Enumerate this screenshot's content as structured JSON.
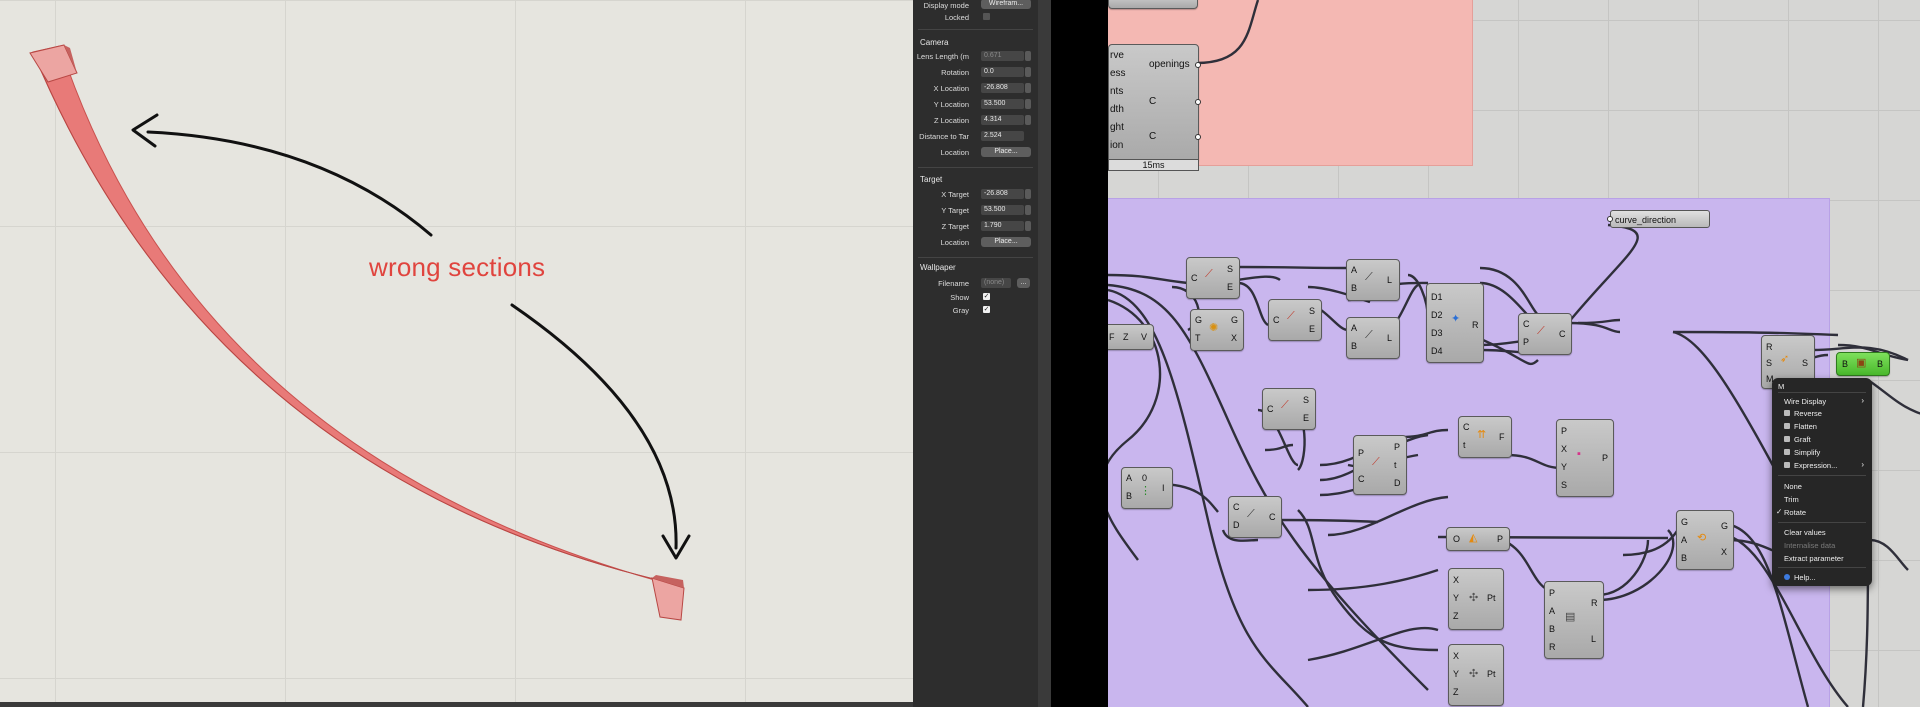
{
  "viewport": {
    "annotation": "wrong sections"
  },
  "panel": {
    "top_row": {
      "label": "Display mode",
      "value": "Wirefram..."
    },
    "locked_label": "Locked",
    "camera_title": "Camera",
    "camera": [
      {
        "label": "Lens Length (m",
        "value": "0.671"
      },
      {
        "label": "Rotation",
        "value": "0.0"
      },
      {
        "label": "X Location",
        "value": "-26.808"
      },
      {
        "label": "Y Location",
        "value": "53.500"
      },
      {
        "label": "Z Location",
        "value": "4.314"
      },
      {
        "label": "Distance to Tar",
        "value": "2.524"
      }
    ],
    "camera_location": {
      "label": "Location",
      "button": "Place..."
    },
    "target_title": "Target",
    "target": [
      {
        "label": "X Target",
        "value": "-26.808"
      },
      {
        "label": "Y Target",
        "value": "53.500"
      },
      {
        "label": "Z Target",
        "value": "1.790"
      }
    ],
    "target_location": {
      "label": "Location",
      "button": "Place..."
    },
    "wallpaper_title": "Wallpaper",
    "filename": {
      "label": "Filename",
      "value": "(none)",
      "button": "..."
    },
    "show_label": "Show",
    "gray_label": "Gray"
  },
  "canvas": {
    "big_node": {
      "inputs": [
        "rve",
        "ess",
        "nts",
        "dth",
        "ght",
        "ion"
      ],
      "outputs": [
        "openings",
        "C",
        "C"
      ],
      "timer": "15ms"
    },
    "panel_param": "curve_direction",
    "nodes": {
      "n1": {
        "in": [
          "C"
        ],
        "out": [
          "S",
          "E"
        ]
      },
      "n2": {
        "in": [
          "A",
          "B"
        ],
        "out": [
          "L"
        ]
      },
      "n3": {
        "in": [
          "D1",
          "D2",
          "D3",
          "D4"
        ],
        "out": [
          "R"
        ]
      },
      "n4": {
        "in": [
          "C",
          "P"
        ],
        "out": [
          "C"
        ]
      },
      "n5": {
        "in": [
          "F"
        ],
        "out": [
          "V"
        ],
        "extra": "Z"
      },
      "n6": {
        "in": [
          "G",
          "T"
        ],
        "out": [
          "G",
          "X"
        ]
      },
      "n7": {
        "in": [
          "C"
        ],
        "out": [
          "S",
          "E"
        ]
      },
      "n8": {
        "in": [
          "A",
          "B"
        ],
        "out": [
          "L"
        ]
      },
      "n9": {
        "in": [
          "R",
          "S",
          "M"
        ],
        "out": [
          "S"
        ]
      },
      "n10": {
        "in": [
          "B"
        ],
        "out": [
          "B"
        ]
      },
      "n11": {
        "in": [
          "C"
        ],
        "out": [
          "S",
          "E"
        ]
      },
      "n12": {
        "in": [
          "P",
          "C"
        ],
        "out": [
          "P",
          "t",
          "D"
        ]
      },
      "n13": {
        "in": [
          "C",
          "t"
        ],
        "out": [
          "F"
        ]
      },
      "n14": {
        "in": [
          "P",
          "X",
          "Y",
          "S"
        ],
        "out": [
          "P"
        ]
      },
      "n15": {
        "in": [
          "A",
          "B"
        ],
        "out": [
          "I"
        ],
        "extra": "0"
      },
      "n16": {
        "in": [
          "C",
          "D"
        ],
        "out": [
          "C"
        ]
      },
      "n17": {
        "in": [
          "O"
        ],
        "out": [
          "P"
        ]
      },
      "n18": {
        "in": [
          "G",
          "A",
          "B"
        ],
        "out": [
          "G",
          "X"
        ]
      },
      "n19": {
        "in": [
          "X",
          "Y",
          "Z"
        ],
        "out": [
          "Pt"
        ]
      },
      "n20": {
        "in": [
          "P",
          "A",
          "B",
          "R"
        ],
        "out": [
          "R",
          "L"
        ]
      },
      "n21": {
        "in": [
          "X",
          "Y",
          "Z"
        ],
        "out": [
          "Pt"
        ]
      }
    }
  },
  "context_menu": {
    "header": "M",
    "items": [
      {
        "label": "Wire Display",
        "submenu": true
      },
      {
        "label": "Reverse",
        "icon": true
      },
      {
        "label": "Flatten",
        "icon": true
      },
      {
        "label": "Graft",
        "icon": true
      },
      {
        "label": "Simplify",
        "icon": true
      },
      {
        "label": "Expression...",
        "icon": true,
        "submenu": true
      }
    ],
    "options": [
      {
        "label": "None"
      },
      {
        "label": "Trim"
      },
      {
        "label": "Rotate",
        "checked": true
      }
    ],
    "actions": [
      {
        "label": "Clear values",
        "disabled": false
      },
      {
        "label": "Internalise data",
        "disabled": true
      },
      {
        "label": "Extract parameter",
        "disabled": false
      }
    ],
    "help": "Help..."
  }
}
